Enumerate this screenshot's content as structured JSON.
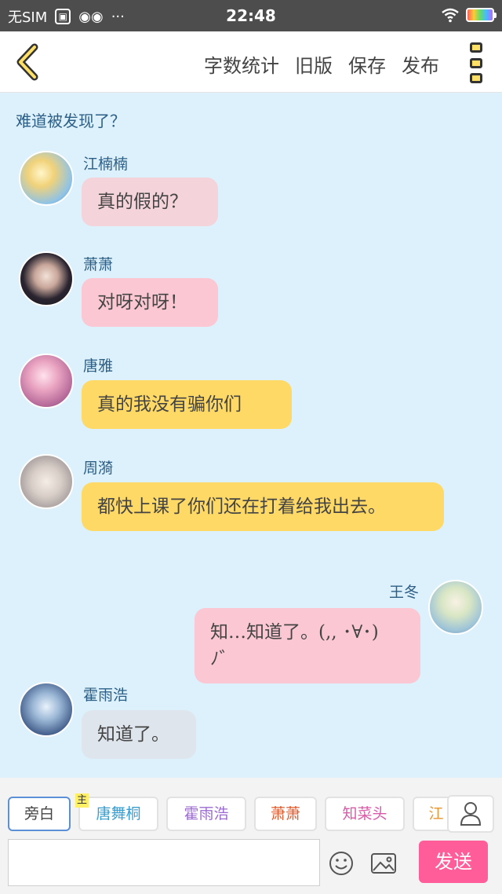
{
  "status_bar": {
    "carrier": "无SIM",
    "time": "22:48",
    "more": "···"
  },
  "header": {
    "actions": [
      "字数统计",
      "旧版",
      "保存",
      "发布"
    ]
  },
  "narration": "难道被发现了？",
  "messages": [
    {
      "name": "江楠楠",
      "text": "真的假的？",
      "side": "left",
      "bubble_color": "#f4d4da"
    },
    {
      "name": "萧萧",
      "text": "对呀对呀！",
      "side": "left",
      "bubble_color": "#fbc7d3"
    },
    {
      "name": "唐雅",
      "text": "真的我没有骗你们",
      "side": "left",
      "bubble_color": "#ffd966"
    },
    {
      "name": "周漪",
      "text": "都快上课了你们还在打着给我出去。",
      "side": "left",
      "bubble_color": "#ffd966"
    },
    {
      "name": "王冬",
      "text": "知…知道了。(,, ･∀･)ﾉ゛",
      "side": "right",
      "bubble_color": "#fbc7d3"
    },
    {
      "name": "霍雨浩",
      "text": "知道了。",
      "side": "left",
      "bubble_color": "#dfe5ec"
    }
  ],
  "characters": [
    {
      "label": "旁白",
      "color": "#555555",
      "selected": true
    },
    {
      "label": "唐舞桐",
      "color": "#3a9fd0",
      "tag": "主"
    },
    {
      "label": "霍雨浩",
      "color": "#9b6bd1"
    },
    {
      "label": "萧萧",
      "color": "#e05a2b"
    },
    {
      "label": "知菜头",
      "color": "#d85aa8"
    },
    {
      "label": "江",
      "color": "#e8952e"
    }
  ],
  "composer": {
    "input_value": "",
    "send_label": "发送"
  },
  "icons": {
    "back": "chevron-left-icon",
    "menu": "more-vertical-icon",
    "user": "user-icon",
    "emoji": "smiley-icon",
    "image": "image-icon"
  },
  "colors": {
    "chat_bg": "#dcf1fb",
    "send_button": "#ff5c9a",
    "accent_yellow": "#ffe066",
    "name_text": "#2d5e86"
  }
}
